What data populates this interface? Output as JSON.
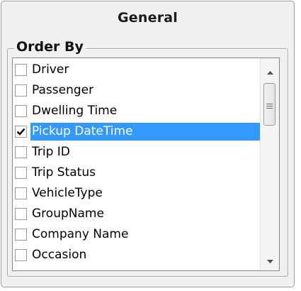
{
  "panel": {
    "title": "General"
  },
  "order_by": {
    "legend": "Order By",
    "items": [
      {
        "label": "Driver",
        "checked": false,
        "selected": false
      },
      {
        "label": "Passenger",
        "checked": false,
        "selected": false
      },
      {
        "label": "Dwelling Time",
        "checked": false,
        "selected": false
      },
      {
        "label": "Pickup DateTime",
        "checked": true,
        "selected": true
      },
      {
        "label": "Trip ID",
        "checked": false,
        "selected": false
      },
      {
        "label": "Trip Status",
        "checked": false,
        "selected": false
      },
      {
        "label": "VehicleType",
        "checked": false,
        "selected": false
      },
      {
        "label": "GroupName",
        "checked": false,
        "selected": false
      },
      {
        "label": "Company Name",
        "checked": false,
        "selected": false
      },
      {
        "label": "Occasion",
        "checked": false,
        "selected": false
      }
    ]
  },
  "scrollbar": {
    "up_icon": "arrow-up-icon",
    "down_icon": "arrow-down-icon",
    "thumb_icon": "grip-icon"
  },
  "colors": {
    "selection": "#3399ff",
    "panel_bg": "#f0f0f0"
  }
}
